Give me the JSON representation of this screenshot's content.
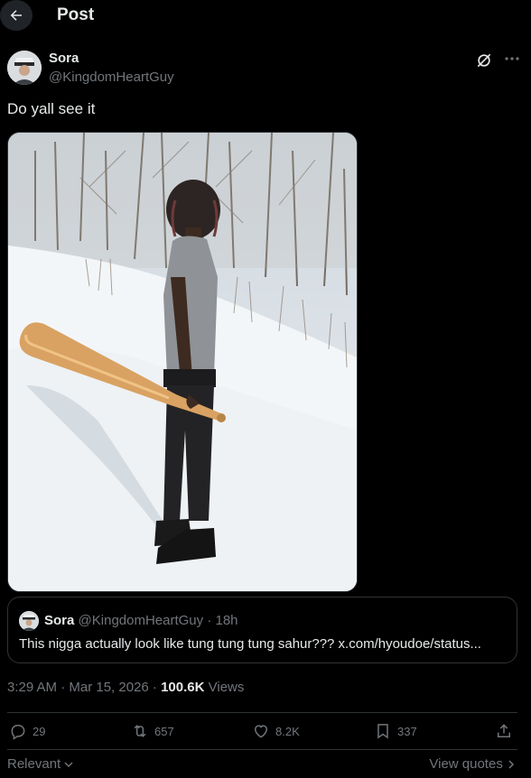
{
  "header": {
    "title": "Post",
    "back_icon": "arrow-left-icon"
  },
  "post": {
    "author": {
      "name": "Sora",
      "handle": "@KingdomHeartGuy"
    },
    "text": "Do yall see it",
    "timestamp": "3:29 AM · Mar 15, 2026 ·",
    "views_count": "100.6K",
    "views_label": "Views"
  },
  "quote": {
    "name": "Sora",
    "meta": "@KingdomHeartGuy · 18h",
    "text": "This nigga actually look like tung tung tung sahur??? x.com/hyoudoe/status..."
  },
  "actions": {
    "replies": "29",
    "reposts": "657",
    "likes": "8.2K",
    "bookmarks": "337"
  },
  "footer": {
    "sort_label": "Relevant",
    "view_quotes_label": "View quotes"
  },
  "colors": {
    "background": "#000000",
    "text": "#e7e9ea",
    "muted": "#71767b",
    "border": "#2f3336"
  }
}
